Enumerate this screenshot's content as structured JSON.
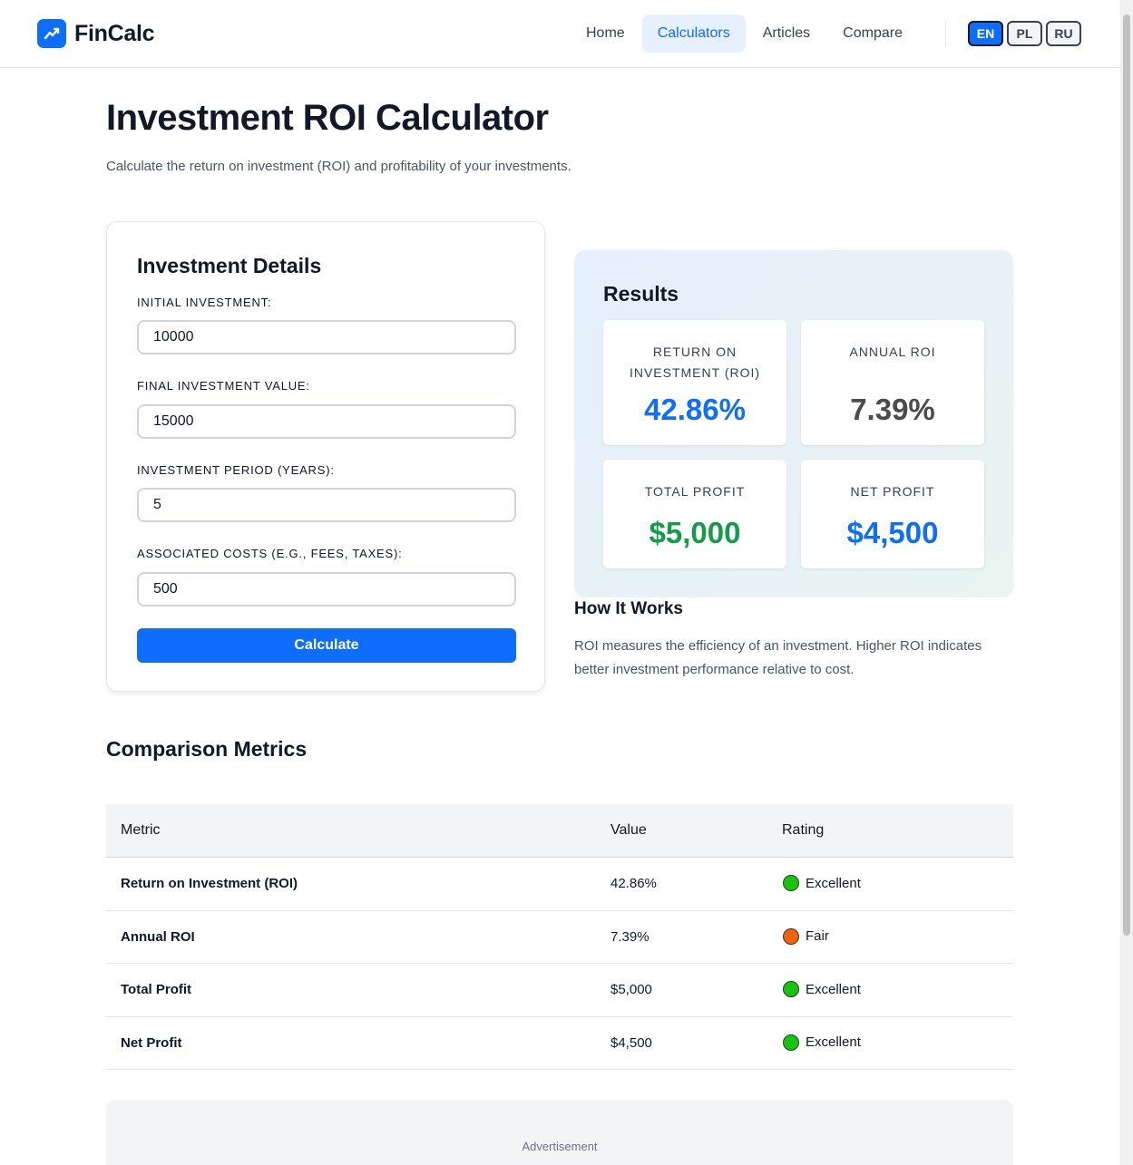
{
  "brand": {
    "name": "FinCalc",
    "icon": "trend-up-icon",
    "color": "#0d6efd"
  },
  "nav": {
    "items": [
      {
        "label": "Home",
        "active": false
      },
      {
        "label": "Calculators",
        "active": true
      },
      {
        "label": "Articles",
        "active": false
      },
      {
        "label": "Compare",
        "active": false
      }
    ],
    "languages": [
      {
        "label": "EN",
        "active": true
      },
      {
        "label": "PL",
        "active": false
      },
      {
        "label": "RU",
        "active": false
      }
    ]
  },
  "page": {
    "title": "Investment ROI Calculator",
    "subtitle": "Calculate the return on investment (ROI) and profitability of your investments."
  },
  "form": {
    "title": "Investment Details",
    "fields": [
      {
        "label": "INITIAL INVESTMENT:",
        "value": "10000"
      },
      {
        "label": "FINAL INVESTMENT VALUE:",
        "value": "15000"
      },
      {
        "label": "INVESTMENT PERIOD (YEARS):",
        "value": "5"
      },
      {
        "label": "ASSOCIATED COSTS (E.G., FEES, TAXES):",
        "value": "500"
      }
    ],
    "button": "Calculate"
  },
  "results": {
    "title": "Results",
    "roi": {
      "label_line1": "RETURN ON",
      "label_line2": "INVESTMENT (ROI)",
      "value": "42.86%",
      "color": "#0d6efd"
    },
    "annual": {
      "label": "ANNUAL ROI",
      "value": "7.39%",
      "color": "#4b4b4b"
    },
    "total_profit": {
      "label": "TOTAL PROFIT",
      "value": "$5,000",
      "color": "#159c4a"
    },
    "net_profit": {
      "label": "NET PROFIT",
      "value": "$4,500",
      "color": "#0d6efd"
    }
  },
  "how": {
    "title": "How It Works",
    "text": "ROI measures the efficiency of an investment. Higher ROI indicates better investment performance relative to cost."
  },
  "comparison": {
    "title": "Comparison Metrics",
    "headers": [
      "Metric",
      "Value",
      "Rating"
    ],
    "rows": [
      {
        "metric": "Return on Investment (ROI)",
        "value": "42.86%",
        "rating": "Excellent",
        "color": "#16c60c"
      },
      {
        "metric": "Annual ROI",
        "value": "7.39%",
        "rating": "Fair",
        "color": "#f7630c"
      },
      {
        "metric": "Total Profit",
        "value": "$5,000",
        "rating": "Excellent",
        "color": "#16c60c"
      },
      {
        "metric": "Net Profit",
        "value": "$4,500",
        "rating": "Excellent",
        "color": "#16c60c"
      }
    ]
  },
  "ad": {
    "label": "Advertisement"
  }
}
